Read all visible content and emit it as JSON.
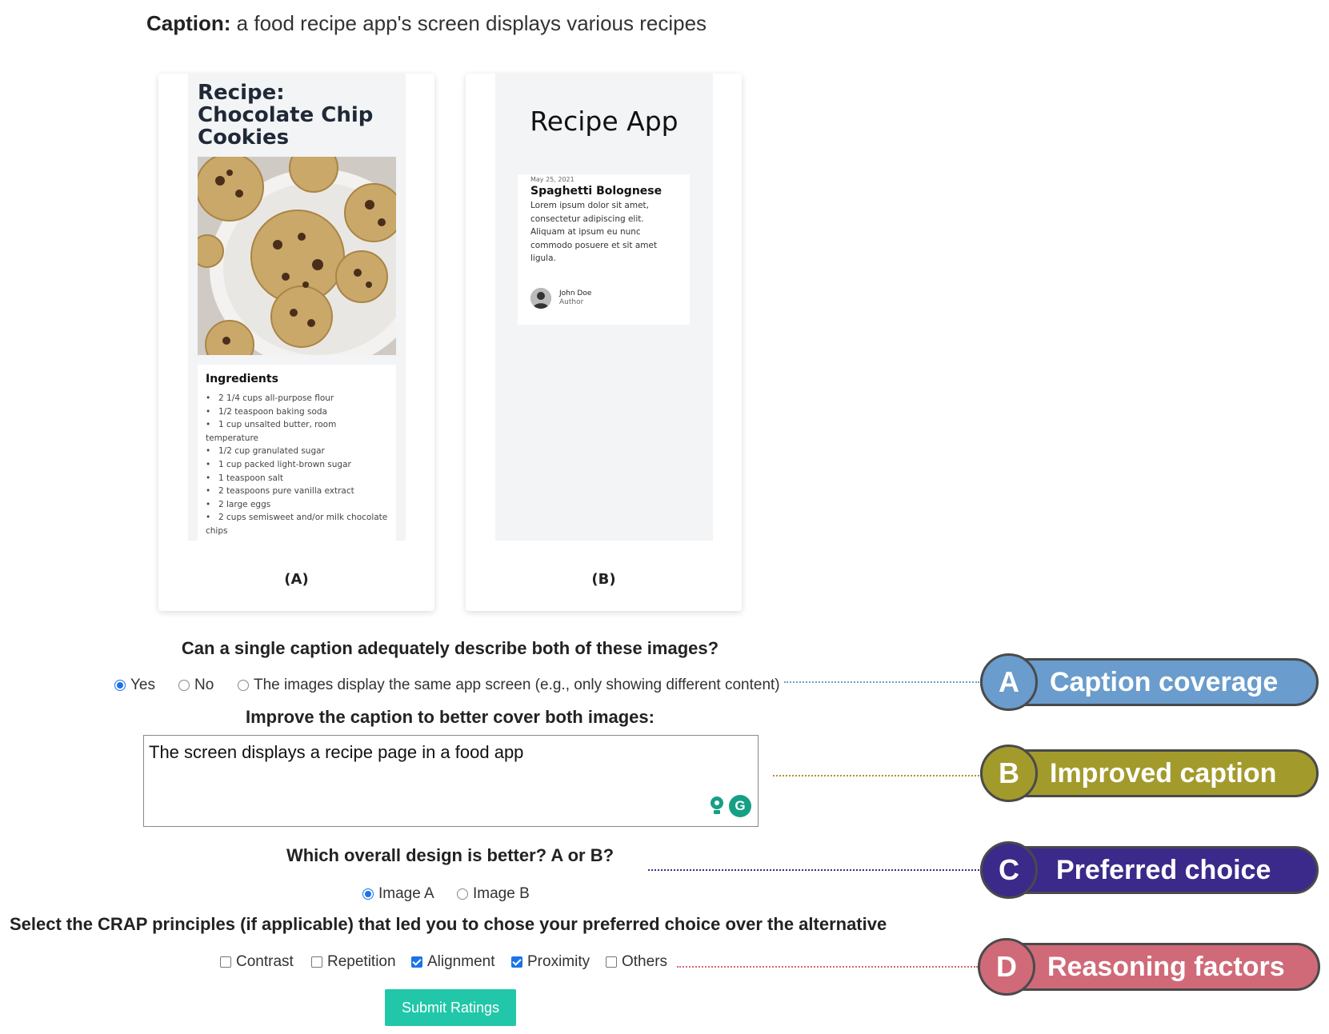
{
  "caption": {
    "label": "Caption:",
    "text": "a food recipe app's screen displays various recipes"
  },
  "image_a": {
    "title": "Recipe: Chocolate Chip Cookies",
    "ingredients_heading": "Ingredients",
    "ingredients": [
      "2 1/4 cups all-purpose flour",
      "1/2 teaspoon baking soda",
      "1 cup unsalted butter, room temperature",
      "1/2 cup granulated sugar",
      "1 cup packed light-brown sugar",
      "1 teaspoon salt",
      "2 teaspoons pure vanilla extract",
      "2 large eggs",
      "2 cups semisweet and/or milk chocolate chips"
    ],
    "label": "(A)"
  },
  "image_b": {
    "app_title": "Recipe App",
    "date": "May 25, 2021",
    "post_title": "Spaghetti Bolognese",
    "post_body": "Lorem ipsum dolor sit amet, consectetur adipiscing elit. Aliquam at ipsum eu nunc commodo posuere et sit amet ligula.",
    "author_name": "John Doe",
    "author_role": "Author",
    "label": "(B)"
  },
  "q_coverage": {
    "question": "Can a single caption adequately describe both of these images?",
    "options": [
      "Yes",
      "No",
      "The images display the same app screen (e.g., only showing different content)"
    ],
    "selected": 0
  },
  "q_improve": {
    "question": "Improve the caption to better cover both images:",
    "value": "The screen displays a recipe page in a food app"
  },
  "q_preferred": {
    "question": "Which overall design is better? A or B?",
    "options": [
      "Image A",
      "Image B"
    ],
    "selected": 0
  },
  "q_crap": {
    "question": "Select the CRAP principles (if applicable) that led you to chose your preferred choice over the alternative",
    "options": [
      "Contrast",
      "Repetition",
      "Alignment",
      "Proximity",
      "Others"
    ],
    "checked": [
      false,
      false,
      true,
      true,
      false
    ]
  },
  "submit_label": "Submit Ratings",
  "annotations": [
    {
      "letter": "A",
      "text": "Caption coverage",
      "color": "#6a9ccd"
    },
    {
      "letter": "B",
      "text": "Improved caption",
      "color": "#a39a2c"
    },
    {
      "letter": "C",
      "text": "Preferred choice",
      "color": "#3b2a8a"
    },
    {
      "letter": "D",
      "text": "Reasoning factors",
      "color": "#d06a78"
    }
  ]
}
